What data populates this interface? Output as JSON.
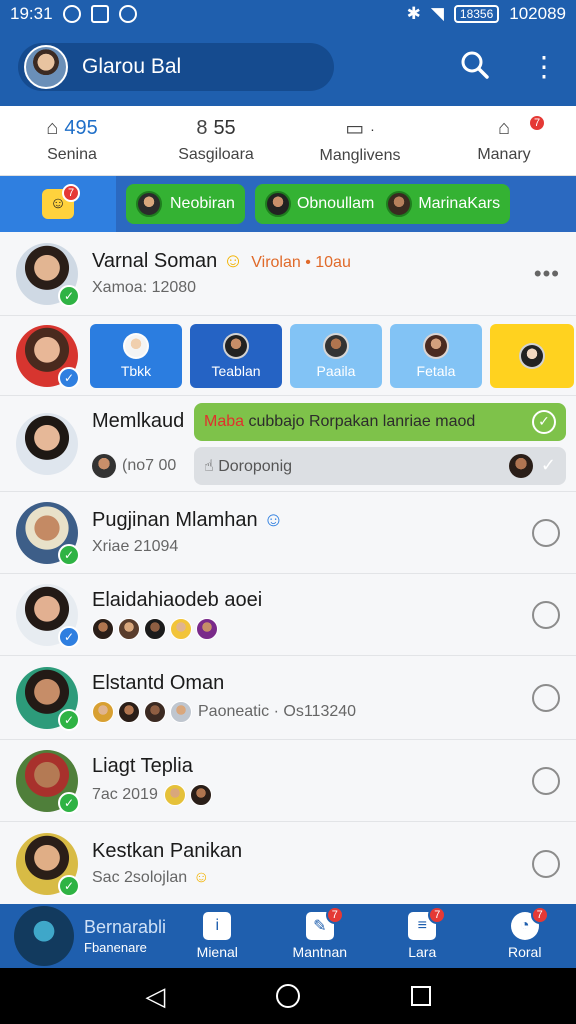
{
  "status_bar": {
    "time": "19:31",
    "battery": "18356",
    "clock_right": "102089"
  },
  "app_bar": {
    "title": "Glarou Bal",
    "search_icon": "search-icon",
    "more_icon": "more-vert-icon"
  },
  "tabs": [
    {
      "count": "495",
      "label": "Senina",
      "icon": "home-icon"
    },
    {
      "count": "55",
      "label": "Sasgiloara",
      "icon": "eight-icon"
    },
    {
      "count": "",
      "label": "Manglivens",
      "icon": "store-icon"
    },
    {
      "count": "",
      "label": "Manary",
      "icon": "home-badge-icon",
      "badge": "7"
    }
  ],
  "filter": {
    "home_badge": "7",
    "chips": [
      {
        "label": "Neobiran"
      },
      {
        "label": "Obnoullam",
        "label2": "MarinaKars"
      }
    ]
  },
  "rows": [
    {
      "name": "Varnal Soman",
      "tag": "Virolan • 10au",
      "sub": "Xamoa: 12080",
      "type": "more"
    },
    {
      "type": "cards",
      "cards": [
        "Tbkk",
        "Teablan",
        "Paaila",
        "Fetala",
        ""
      ]
    },
    {
      "name": "Memlkaud",
      "sub": "(no7 00",
      "bubble1_a": "Maba",
      "bubble1_b": "cubbajo Rorpakan lanriae maod",
      "bubble2": "Doroponig",
      "type": "bubbles"
    },
    {
      "name": "Pugjinan Mlamhan",
      "sub": "Xriae 21094",
      "type": "radio"
    },
    {
      "name": "Elaidahiaodeb aoei",
      "sub": "",
      "type": "radio",
      "avatars": 5
    },
    {
      "name": "Elstantd Oman",
      "sub": "Paoneatic · Os113240",
      "type": "radio",
      "avatars": 4
    },
    {
      "name": "Liagt Teplia",
      "sub": "7ac 2019",
      "type": "radio",
      "avatars": 2
    },
    {
      "name": "Kestkan Panikan",
      "sub": "Sac 2solojlan",
      "type": "radio"
    }
  ],
  "bottom_nav": {
    "first_name": "Bernarabli",
    "first_label": "Fbanenare",
    "items": [
      {
        "label": "Mienal",
        "icon": "info-icon"
      },
      {
        "label": "Mantnan",
        "icon": "edit-icon",
        "badge": "7"
      },
      {
        "label": "Lara",
        "icon": "doc-icon",
        "badge": "7"
      },
      {
        "label": "Roral",
        "icon": "gauge-icon",
        "badge": "7"
      }
    ]
  },
  "colors": {
    "primary": "#1f5fae",
    "green": "#34b233",
    "accent_blue": "#2f7fe0"
  }
}
